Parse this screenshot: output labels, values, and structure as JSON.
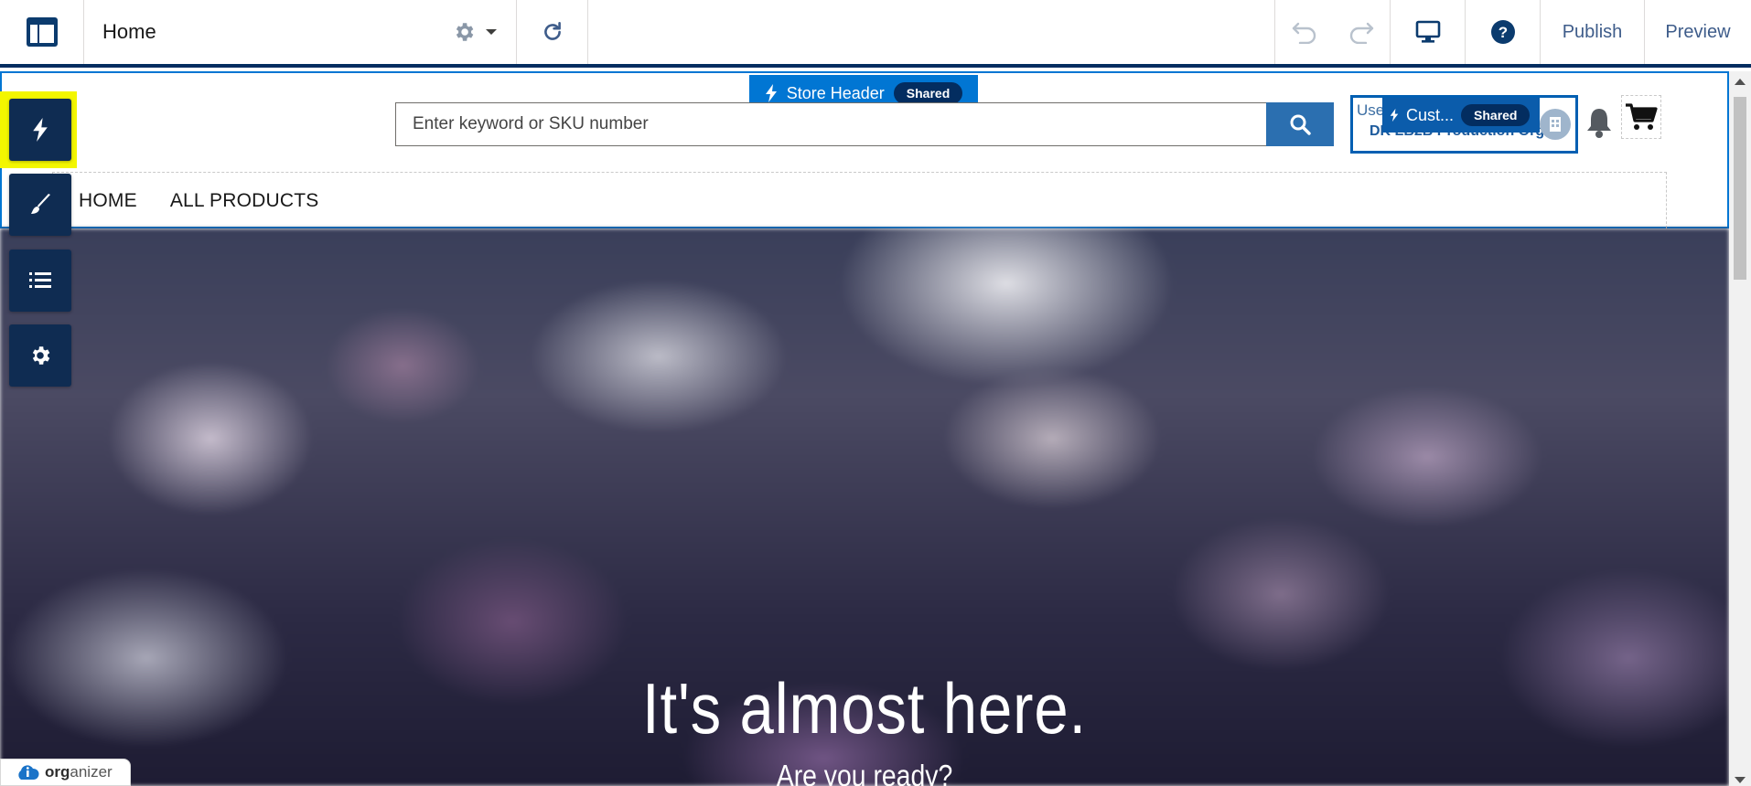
{
  "toolbar": {
    "page_name": "Home",
    "publish_label": "Publish",
    "preview_label": "Preview"
  },
  "canvas": {
    "header_region": {
      "tag_label": "Store Header",
      "tag_badge": "Shared"
    },
    "search": {
      "placeholder": "Enter keyword or SKU number"
    },
    "user_component": {
      "underlying_label": "User",
      "underlying_org": "DK LB2B Production Org",
      "tag_label": "Cust...",
      "tag_badge": "Shared"
    },
    "nav": {
      "items": [
        "HOME",
        "ALL PRODUCTS"
      ]
    },
    "hero": {
      "title": "It's almost here.",
      "subtitle": "Are you ready?"
    }
  },
  "side_panel": {
    "buttons": [
      "components-icon",
      "theme-brush-icon",
      "page-structure-list-icon",
      "settings-gear-icon"
    ]
  },
  "organizer": {
    "brand_bold": "org",
    "brand_rest": "anizer"
  },
  "colors": {
    "toolbar_border": "#032d60",
    "region_outline": "#0176d3",
    "side_button": "#0f2c52",
    "highlight": "#f3f600",
    "search_button": "#2b6fb0"
  }
}
